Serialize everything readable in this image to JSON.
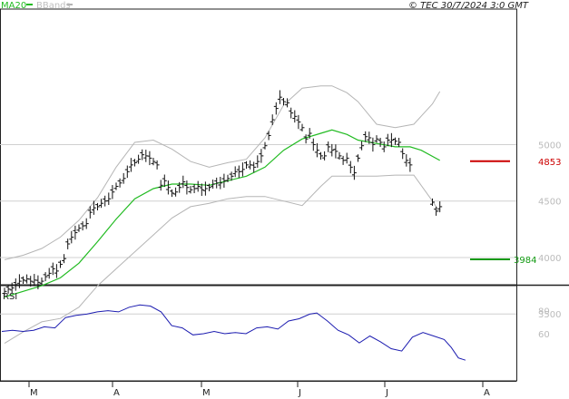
{
  "header": {
    "legend_ma": "MA20",
    "legend_bb": "BBands",
    "copyright": "© TEC 30/7/2024 3:0 GMT"
  },
  "colors": {
    "ma": "#22bb22",
    "bb": "#b5b5b5",
    "price": "#111111",
    "rsi": "#1c1cb0",
    "resistance": "#cc0000",
    "support": "#119911",
    "grid": "#d0d0d0",
    "axis": "#222222"
  },
  "rsi_panel": {
    "label": "RSI"
  },
  "chart_data": [
    {
      "type": "ohlc",
      "title": "",
      "x_tick_labels": [
        "M",
        "A",
        "M",
        "J",
        "J",
        "A"
      ],
      "y_ticks": [
        3500,
        4000,
        4500,
        5000
      ],
      "ylim": [
        3100,
        5500
      ],
      "grid": true,
      "legend": [
        "MA20",
        "BBands"
      ],
      "legend_placement": "top-left",
      "levels": [
        {
          "name": "resistance",
          "value": 4853,
          "label": "4853"
        },
        {
          "name": "support",
          "value": 3984,
          "label": "3984"
        }
      ],
      "series": [
        {
          "name": "Price",
          "points": [
            [
              0,
              3700
            ],
            [
              1,
              3720
            ],
            [
              2,
              3730
            ],
            [
              3,
              3760
            ],
            [
              4,
              3790
            ],
            [
              5,
              3800
            ],
            [
              6,
              3810
            ],
            [
              7,
              3790
            ],
            [
              8,
              3800
            ],
            [
              9,
              3780
            ],
            [
              10,
              3790
            ],
            [
              11,
              3830
            ],
            [
              12,
              3860
            ],
            [
              13,
              3900
            ],
            [
              14,
              3880
            ],
            [
              15,
              3940
            ],
            [
              16,
              3990
            ],
            [
              17,
              4120
            ],
            [
              18,
              4180
            ],
            [
              19,
              4220
            ],
            [
              20,
              4260
            ],
            [
              21,
              4280
            ],
            [
              22,
              4300
            ],
            [
              23,
              4400
            ],
            [
              24,
              4440
            ],
            [
              25,
              4450
            ],
            [
              26,
              4480
            ],
            [
              27,
              4500
            ],
            [
              28,
              4520
            ],
            [
              29,
              4580
            ],
            [
              30,
              4630
            ],
            [
              31,
              4660
            ],
            [
              32,
              4700
            ],
            [
              33,
              4760
            ],
            [
              34,
              4820
            ],
            [
              35,
              4840
            ],
            [
              36,
              4870
            ],
            [
              37,
              4910
            ],
            [
              38,
              4900
            ],
            [
              39,
              4880
            ],
            [
              40,
              4850
            ],
            [
              41,
              4820
            ],
            [
              42,
              4640
            ],
            [
              43,
              4680
            ],
            [
              44,
              4620
            ],
            [
              45,
              4570
            ],
            [
              46,
              4580
            ],
            [
              47,
              4620
            ],
            [
              48,
              4670
            ],
            [
              49,
              4620
            ],
            [
              50,
              4600
            ],
            [
              51,
              4610
            ],
            [
              52,
              4630
            ],
            [
              53,
              4600
            ],
            [
              54,
              4610
            ],
            [
              55,
              4620
            ],
            [
              56,
              4650
            ],
            [
              57,
              4660
            ],
            [
              58,
              4660
            ],
            [
              59,
              4680
            ],
            [
              60,
              4700
            ],
            [
              61,
              4720
            ],
            [
              62,
              4760
            ],
            [
              63,
              4760
            ],
            [
              64,
              4780
            ],
            [
              65,
              4820
            ],
            [
              66,
              4820
            ],
            [
              67,
              4800
            ],
            [
              68,
              4850
            ],
            [
              69,
              4900
            ],
            [
              70,
              4990
            ],
            [
              71,
              5080
            ],
            [
              72,
              5220
            ],
            [
              73,
              5320
            ],
            [
              74,
              5420
            ],
            [
              75,
              5380
            ],
            [
              76,
              5370
            ],
            [
              77,
              5280
            ],
            [
              78,
              5250
            ],
            [
              79,
              5200
            ],
            [
              80,
              5150
            ],
            [
              81,
              5050
            ],
            [
              82,
              5100
            ],
            [
              83,
              5000
            ],
            [
              84,
              4950
            ],
            [
              85,
              4900
            ],
            [
              86,
              4900
            ],
            [
              87,
              4980
            ],
            [
              88,
              4950
            ],
            [
              89,
              4940
            ],
            [
              90,
              4900
            ],
            [
              91,
              4860
            ],
            [
              92,
              4880
            ],
            [
              93,
              4800
            ],
            [
              94,
              4750
            ],
            [
              95,
              4880
            ],
            [
              96,
              4990
            ],
            [
              97,
              5070
            ],
            [
              98,
              5060
            ],
            [
              99,
              5000
            ],
            [
              100,
              5050
            ],
            [
              101,
              5020
            ],
            [
              102,
              4980
            ],
            [
              103,
              5040
            ],
            [
              104,
              5040
            ],
            [
              105,
              5030
            ],
            [
              106,
              5020
            ],
            [
              107,
              4920
            ],
            [
              108,
              4860
            ],
            [
              109,
              4820
            ],
            [
              115,
              4490
            ],
            [
              116,
              4410
            ],
            [
              117,
              4450
            ]
          ]
        },
        {
          "name": "MA20",
          "points": [
            [
              0,
              3650
            ],
            [
              5,
              3700
            ],
            [
              10,
              3750
            ],
            [
              15,
              3820
            ],
            [
              20,
              3950
            ],
            [
              25,
              4140
            ],
            [
              30,
              4340
            ],
            [
              35,
              4520
            ],
            [
              40,
              4610
            ],
            [
              45,
              4650
            ],
            [
              50,
              4650
            ],
            [
              55,
              4640
            ],
            [
              60,
              4680
            ],
            [
              65,
              4720
            ],
            [
              70,
              4800
            ],
            [
              75,
              4950
            ],
            [
              80,
              5050
            ],
            [
              85,
              5100
            ],
            [
              88,
              5130
            ],
            [
              92,
              5090
            ],
            [
              95,
              5040
            ],
            [
              100,
              5010
            ],
            [
              105,
              4980
            ],
            [
              109,
              4980
            ],
            [
              112,
              4950
            ],
            [
              117,
              4860
            ]
          ]
        },
        {
          "name": "BBands upper",
          "points": [
            [
              0,
              3980
            ],
            [
              5,
              4020
            ],
            [
              10,
              4080
            ],
            [
              15,
              4180
            ],
            [
              20,
              4330
            ],
            [
              25,
              4530
            ],
            [
              30,
              4800
            ],
            [
              35,
              5020
            ],
            [
              40,
              5040
            ],
            [
              45,
              4960
            ],
            [
              50,
              4850
            ],
            [
              55,
              4800
            ],
            [
              60,
              4840
            ],
            [
              65,
              4870
            ],
            [
              70,
              5060
            ],
            [
              75,
              5350
            ],
            [
              80,
              5500
            ],
            [
              85,
              5520
            ],
            [
              88,
              5520
            ],
            [
              92,
              5460
            ],
            [
              95,
              5380
            ],
            [
              100,
              5180
            ],
            [
              105,
              5150
            ],
            [
              110,
              5180
            ],
            [
              115,
              5360
            ],
            [
              117,
              5470
            ]
          ]
        },
        {
          "name": "BBands lower",
          "points": [
            [
              0,
              3240
            ],
            [
              5,
              3340
            ],
            [
              10,
              3430
            ],
            [
              15,
              3460
            ],
            [
              20,
              3560
            ],
            [
              25,
              3750
            ],
            [
              30,
              3900
            ],
            [
              35,
              4050
            ],
            [
              40,
              4200
            ],
            [
              45,
              4350
            ],
            [
              50,
              4450
            ],
            [
              55,
              4480
            ],
            [
              60,
              4520
            ],
            [
              65,
              4540
            ],
            [
              70,
              4540
            ],
            [
              75,
              4500
            ],
            [
              80,
              4460
            ],
            [
              85,
              4630
            ],
            [
              88,
              4720
            ],
            [
              92,
              4720
            ],
            [
              95,
              4720
            ],
            [
              100,
              4720
            ],
            [
              105,
              4730
            ],
            [
              110,
              4730
            ],
            [
              115,
              4500
            ],
            [
              117,
              4400
            ]
          ]
        }
      ]
    },
    {
      "type": "line",
      "title": "RSI",
      "x_tick_labels": [
        "M",
        "A",
        "M",
        "J",
        "J",
        "A"
      ],
      "y_ticks": [
        60,
        80
      ],
      "ylim": [
        30,
        100
      ],
      "series": [
        {
          "name": "RSI",
          "points": [
            [
              0,
              62
            ],
            [
              3,
              63
            ],
            [
              6,
              62
            ],
            [
              9,
              63
            ],
            [
              12,
              66
            ],
            [
              15,
              65
            ],
            [
              18,
              74
            ],
            [
              21,
              76
            ],
            [
              24,
              77
            ],
            [
              27,
              79
            ],
            [
              30,
              80
            ],
            [
              33,
              79
            ],
            [
              36,
              83
            ],
            [
              39,
              85
            ],
            [
              42,
              84
            ],
            [
              45,
              79
            ],
            [
              48,
              67
            ],
            [
              51,
              65
            ],
            [
              54,
              59
            ],
            [
              57,
              60
            ],
            [
              60,
              62
            ],
            [
              63,
              60
            ],
            [
              66,
              61
            ],
            [
              69,
              60
            ],
            [
              72,
              65
            ],
            [
              75,
              66
            ],
            [
              78,
              64
            ],
            [
              81,
              71
            ],
            [
              84,
              73
            ],
            [
              87,
              77
            ],
            [
              89,
              78
            ],
            [
              92,
              71
            ],
            [
              95,
              63
            ],
            [
              98,
              59
            ],
            [
              101,
              52
            ],
            [
              104,
              58
            ],
            [
              107,
              53
            ],
            [
              110,
              47
            ],
            [
              113,
              45
            ],
            [
              116,
              57
            ],
            [
              119,
              61
            ],
            [
              122,
              58
            ],
            [
              125,
              55
            ],
            [
              127,
              48
            ],
            [
              129,
              39
            ],
            [
              131,
              37
            ]
          ]
        }
      ]
    }
  ]
}
